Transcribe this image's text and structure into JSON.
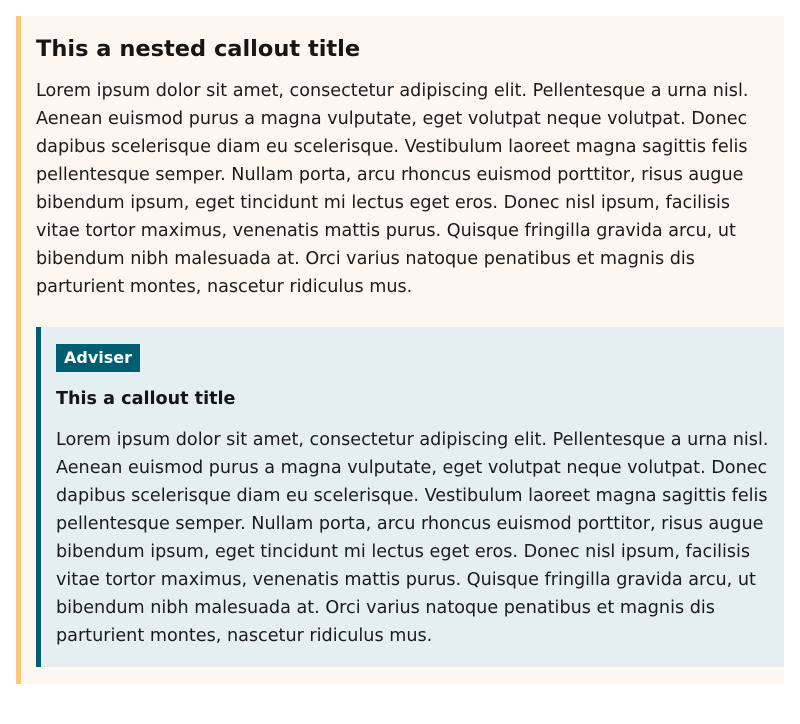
{
  "outer_callout": {
    "title": "This a nested callout title",
    "body": "Lorem ipsum dolor sit amet, consectetur adipiscing elit. Pellentesque a urna nisl. Aenean euismod purus a magna vulputate, eget volutpat neque volutpat. Donec dapibus scelerisque diam eu scelerisque. Vestibulum laoreet magna sagittis felis pellentesque semper. Nullam porta, arcu rhoncus euismod porttitor, risus augue bibendum ipsum, eget tincidunt mi lectus eget eros. Donec nisl ipsum, facilisis vitae tortor maximus, venenatis mattis purus. Quisque fringilla gravida arcu, ut bibendum nibh malesuada at. Orci varius natoque penatibus et magnis dis parturient montes, nascetur ridiculus mus.",
    "accent_color": "#f9c77a",
    "background_color": "#fef6f0"
  },
  "inner_callout": {
    "badge": "Adviser",
    "title": "This a callout title",
    "body": "Lorem ipsum dolor sit amet, consectetur adipiscing elit. Pellentesque a urna nisl. Aenean euismod purus a magna vulputate, eget volutpat neque volutpat. Donec dapibus scelerisque diam eu scelerisque. Vestibulum laoreet magna sagittis felis pellentesque semper. Nullam porta, arcu rhoncus euismod porttitor, risus augue bibendum ipsum, eget tincidunt mi lectus eget eros. Donec nisl ipsum, facilisis vitae tortor maximus, venenatis mattis purus. Quisque fringilla gravida arcu, ut bibendum nibh malesuada at. Orci varius natoque penatibus et magnis dis parturient montes, nascetur ridiculus mus.",
    "accent_color": "#005e72",
    "background_color": "#e5eef1"
  }
}
